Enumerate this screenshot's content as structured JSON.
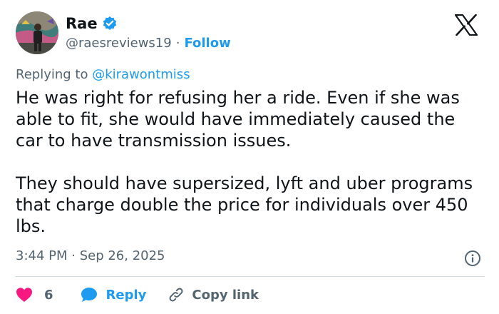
{
  "user": {
    "name": "Rae",
    "handle": "@raesreviews19",
    "follow_label": "Follow"
  },
  "reply_context": {
    "prefix": "Replying to",
    "mention": "@kirawontmiss"
  },
  "tweet": {
    "paragraphs": [
      "He was right for refusing her a ride. Even if she was able to fit, she would have immediately caused the car to have transmission issues.",
      "They should have supersized, lyft and uber programs that charge double the price for individuals over 450 lbs."
    ],
    "timestamp": "3:44 PM · Sep 26, 2025"
  },
  "actions": {
    "like_count": "6",
    "reply_label": "Reply",
    "copy_link_label": "Copy link"
  },
  "icons": {
    "verified": "verified-badge-icon",
    "logo": "x-logo-icon",
    "info": "info-icon",
    "like": "heart-icon",
    "reply": "reply-bubble-icon",
    "copy": "link-icon"
  },
  "colors": {
    "accent": "#1d9bf0",
    "like": "#f91880",
    "text": "#0f1419",
    "muted": "#536471",
    "divider": "#cfd9de"
  }
}
